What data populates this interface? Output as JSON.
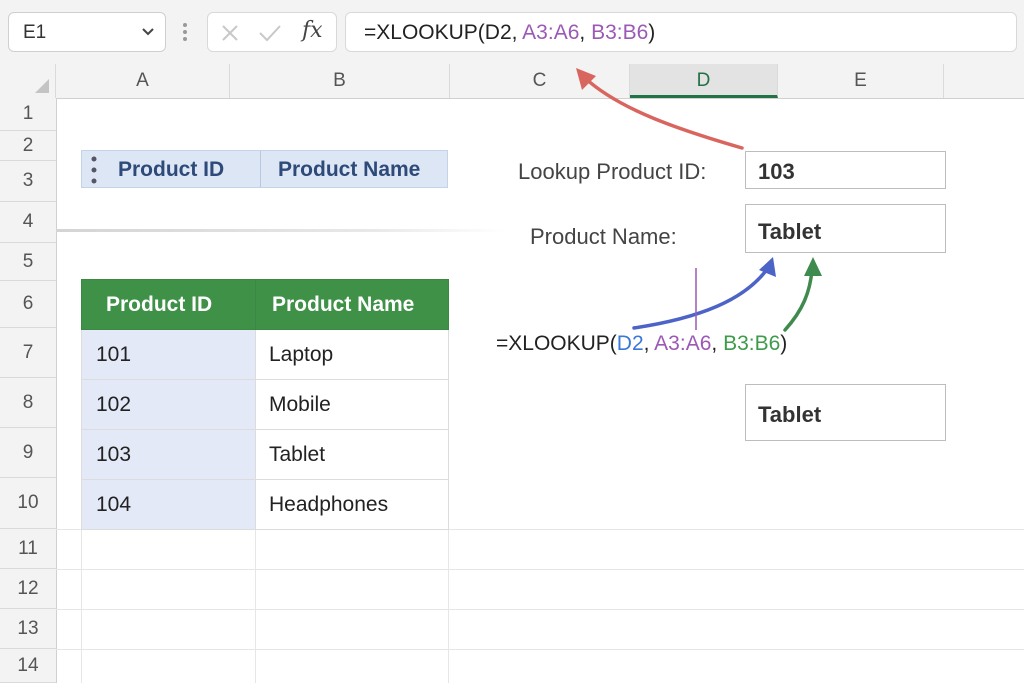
{
  "formula_bar": {
    "name_box": "E1",
    "fx_label": "fx",
    "formula_prefix": "=XLOOKUP(",
    "formula_arg1": "D2",
    "formula_sep1": ", ",
    "formula_arg2": "A3:A6",
    "formula_sep2": ", ",
    "formula_arg3": "B3:B6",
    "formula_suffix": ")"
  },
  "columns": [
    "A",
    "B",
    "C",
    "D",
    "E"
  ],
  "selected_column": "D",
  "rows": [
    "1",
    "2",
    "3",
    "4",
    "5",
    "6",
    "7",
    "8",
    "9",
    "10",
    "11",
    "12",
    "13",
    "14"
  ],
  "header_strip": {
    "col1": "Product ID",
    "col2": "Product Name"
  },
  "table": {
    "headers": [
      "Product ID",
      "Product Name"
    ],
    "rows": [
      [
        "101",
        "Laptop"
      ],
      [
        "102",
        "Mobile"
      ],
      [
        "103",
        "Tablet"
      ],
      [
        "104",
        "Headphones"
      ]
    ]
  },
  "lookup": {
    "id_label": "Lookup Product ID:",
    "id_value": "103",
    "name_label": "Product Name:",
    "name_value": "Tablet",
    "result_value": "Tablet"
  },
  "annotation_formula": {
    "prefix": "=XLOOKUP(",
    "arg1": "D2",
    "sep1": ", ",
    "arg2": "A3:A6",
    "sep2": ", ",
    "arg3": "B3:B6",
    "suffix": ")"
  },
  "colors": {
    "table_header_green": "#3f9148",
    "id_column_fill": "#e3e9f6",
    "header_strip_fill": "#dce6f4",
    "arg_blue": "#3b78d8",
    "arg_purple": "#9b59b6",
    "arg_green": "#3d9b4a",
    "arrow_red": "#d9655f",
    "arrow_blue": "#4c63c8",
    "arrow_green": "#3f8a4e"
  }
}
